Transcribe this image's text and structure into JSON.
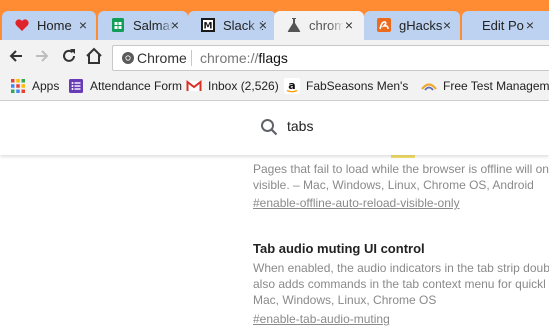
{
  "tabs": [
    {
      "title": "Home",
      "close": "×"
    },
    {
      "title": "Salman",
      "close": "×"
    },
    {
      "title": "Slack S",
      "close": "×"
    },
    {
      "title": "chrome",
      "close": "×"
    },
    {
      "title": "gHacks",
      "close": "×"
    },
    {
      "title": "Edit Po",
      "close": "×"
    }
  ],
  "toolbar": {
    "omnibox_scheme": "Chrome",
    "omnibox_url_prefix": "chrome://",
    "omnibox_url_host": "flags"
  },
  "bookmarks": [
    {
      "label": "Apps"
    },
    {
      "label": "Attendance Form"
    },
    {
      "label": "Inbox (2,526)"
    },
    {
      "label": "FabSeasons Men's Po"
    },
    {
      "label": "Free Test Manageme"
    }
  ],
  "search": {
    "query": "tabs"
  },
  "flags": {
    "offline_reload": {
      "desc_line1": "Pages that fail to load while the browser is offline will on",
      "desc_line2": "visible. – Mac, Windows, Linux, Chrome OS, Android",
      "link": "#enable-offline-auto-reload-visible-only"
    },
    "audio_muting": {
      "title": "Tab audio muting UI control",
      "desc_line1": "When enabled, the audio indicators in the tab strip doubl",
      "desc_line2": "also adds commands in the tab context menu for quickl",
      "desc_line3": "Mac, Windows, Linux, Chrome OS",
      "link": "#enable-tab-audio-muting"
    }
  },
  "colors": {
    "tabstrip": "#ff8c33",
    "tab_inactive": "#bcd2f0",
    "tab_active": "#f2f2f2",
    "search_highlight": "#f6e26d"
  }
}
